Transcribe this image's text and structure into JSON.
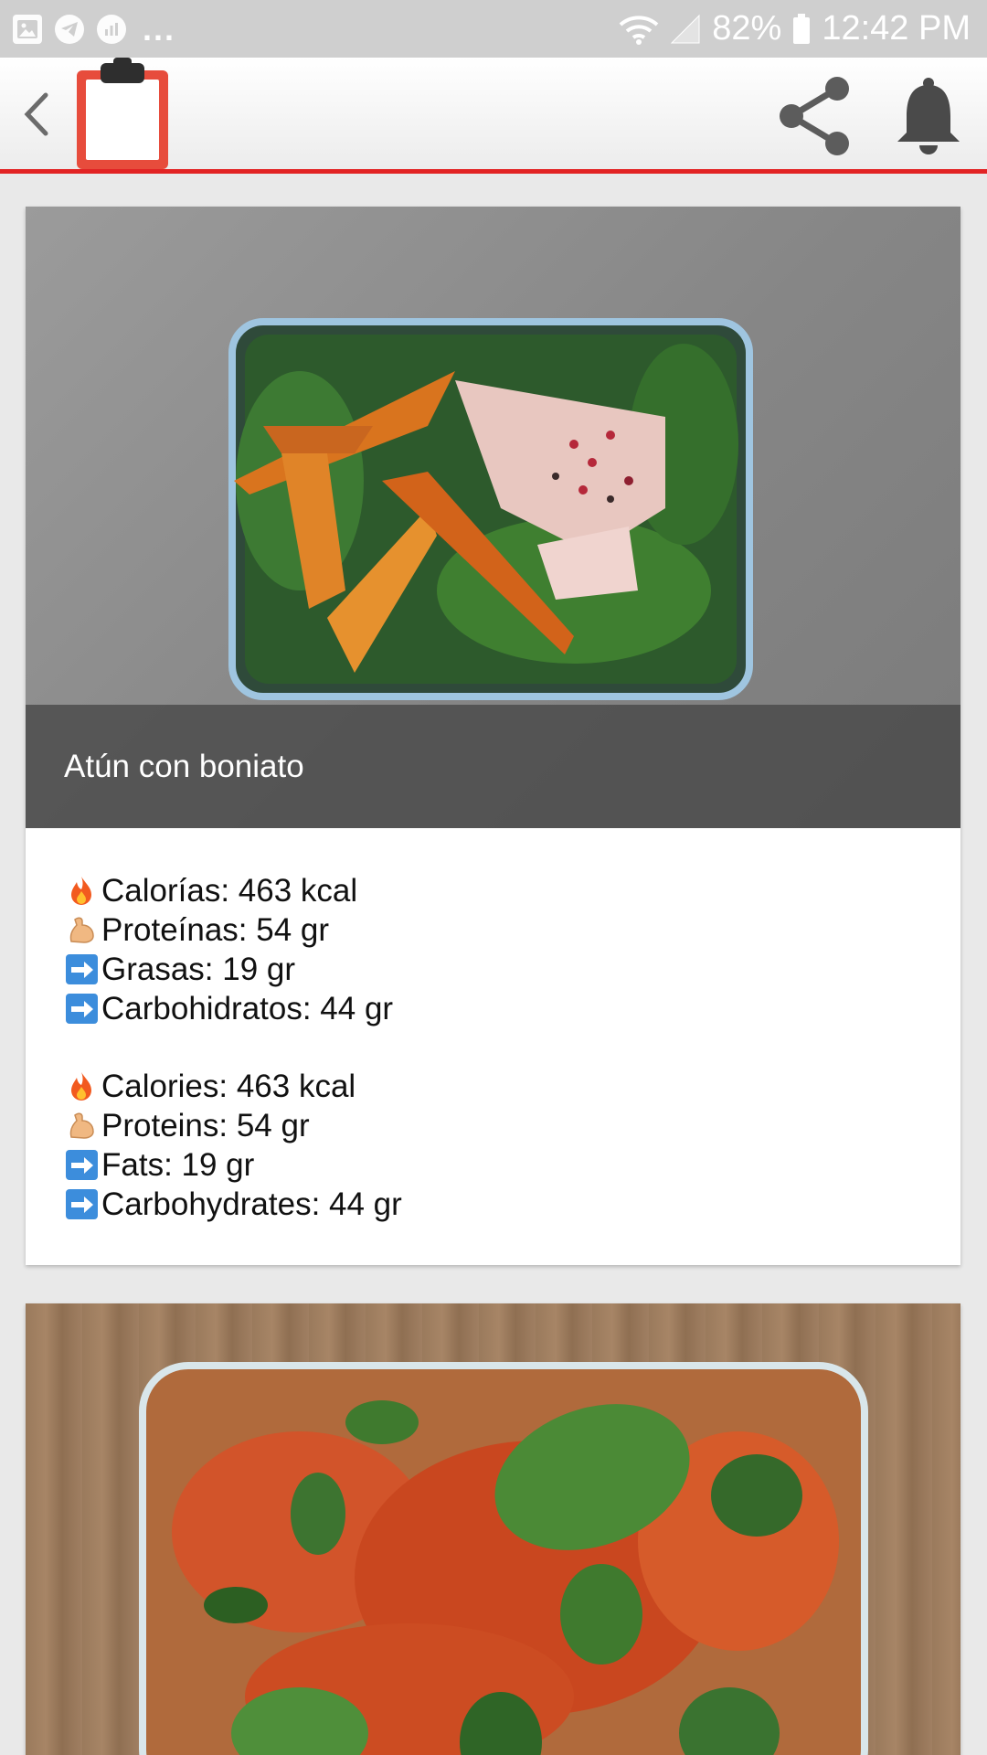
{
  "status_bar": {
    "left_icons": [
      "image-icon",
      "telegram-icon",
      "chart-icon"
    ],
    "more": "...",
    "battery": "82%",
    "time": "12:42 PM"
  },
  "app_bar": {
    "back_icon": "chevron-left-icon",
    "logo_icon": "clipboard-icon",
    "share_icon": "share-icon",
    "bell_icon": "bell-icon"
  },
  "colors": {
    "accent": "#e22324",
    "status_bar": "#cfcfcf"
  },
  "cards": [
    {
      "title": "Atún con boniato",
      "nutrition_es": [
        {
          "icon": "fire-icon",
          "text": "Calorías: 463 kcal"
        },
        {
          "icon": "flexed-biceps-icon",
          "text": "Proteínas: 54 gr"
        },
        {
          "icon": "right-arrow-icon",
          "text": "Grasas: 19 gr"
        },
        {
          "icon": "right-arrow-icon",
          "text": "Carbohidratos: 44 gr"
        }
      ],
      "nutrition_en": [
        {
          "icon": "fire-icon",
          "text": "Calories: 463 kcal"
        },
        {
          "icon": "flexed-biceps-icon",
          "text": "Proteins: 54 gr"
        },
        {
          "icon": "right-arrow-icon",
          "text": "Fats: 19 gr"
        },
        {
          "icon": "right-arrow-icon",
          "text": "Carbohydrates: 44 gr"
        }
      ]
    }
  ]
}
